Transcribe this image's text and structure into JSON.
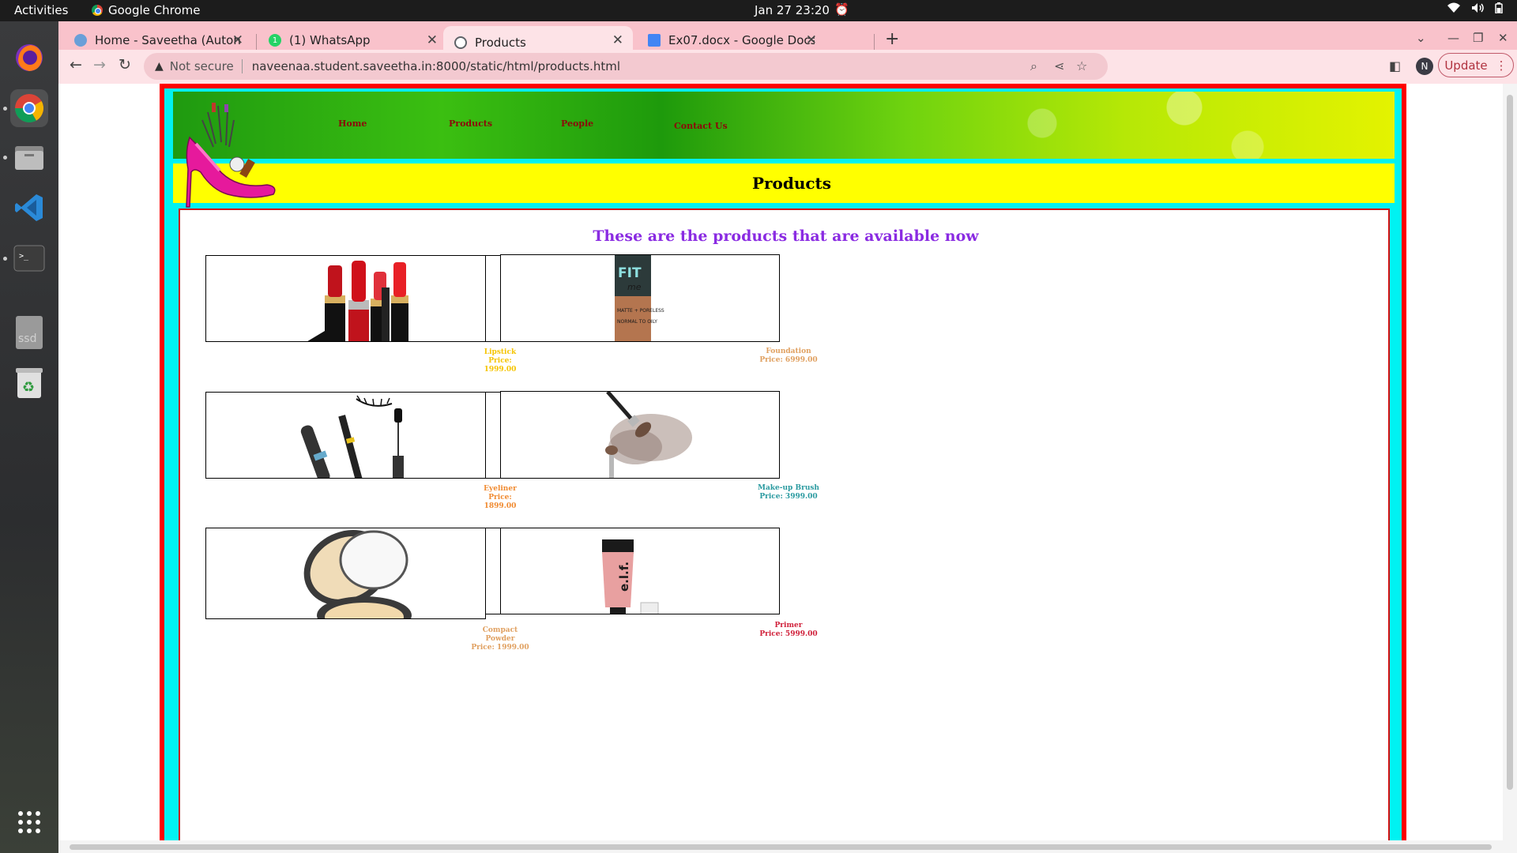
{
  "system": {
    "activities": "Activities",
    "app_name": "Google Chrome",
    "clock": "Jan 27  23:20"
  },
  "tabs": [
    {
      "title": "Home - Saveetha (Autono",
      "favicon_color": "#6a9fd8"
    },
    {
      "title": "(1) WhatsApp",
      "favicon_color": "#25d366",
      "badge": "1"
    },
    {
      "title": "Products",
      "favicon_color": "#5f6368"
    },
    {
      "title": "Ex07.docx - Google Docs",
      "favicon_color": "#4285f4"
    }
  ],
  "toolbar": {
    "not_secure": "Not secure",
    "url": "naveenaa.student.saveetha.in:8000/static/html/products.html",
    "update_label": "Update",
    "avatar_initial": "N"
  },
  "site": {
    "nav": [
      "Home",
      "Products",
      "People",
      "Contact Us"
    ],
    "ribbon_title": "Products",
    "heading": "These are the products that are available now",
    "products": [
      {
        "name": "Lipstick",
        "price": "Price: 1999.00",
        "color": "#f5c400"
      },
      {
        "name": "Foundation",
        "price": "Price: 6999.00",
        "color": "#e0a060"
      },
      {
        "name": "Eyeliner",
        "price": "Price: 1899.00",
        "color": "#f08a30"
      },
      {
        "name": "Make-up Brush",
        "price": "Price: 3999.00",
        "color": "#2a9aa0"
      },
      {
        "name": "Compact Powder",
        "price": "Price: 1999.00",
        "color": "#e0a060"
      },
      {
        "name": "Primer",
        "price": "Price: 5999.00",
        "color": "#d0203a"
      }
    ],
    "foundation_label": {
      "brand": "FIT",
      "sub": "me",
      "text1": "MATTE + PORELESS",
      "text2": "NORMAL TO OILY"
    },
    "primer_label": "e.l.f."
  },
  "colors": {
    "frame_red": "#ff0000",
    "frame_cyan": "#00f2f2",
    "ribbon_yellow": "#ffff00",
    "heading_purple": "#8a2be2",
    "nav_text": "#8b0a0a"
  }
}
